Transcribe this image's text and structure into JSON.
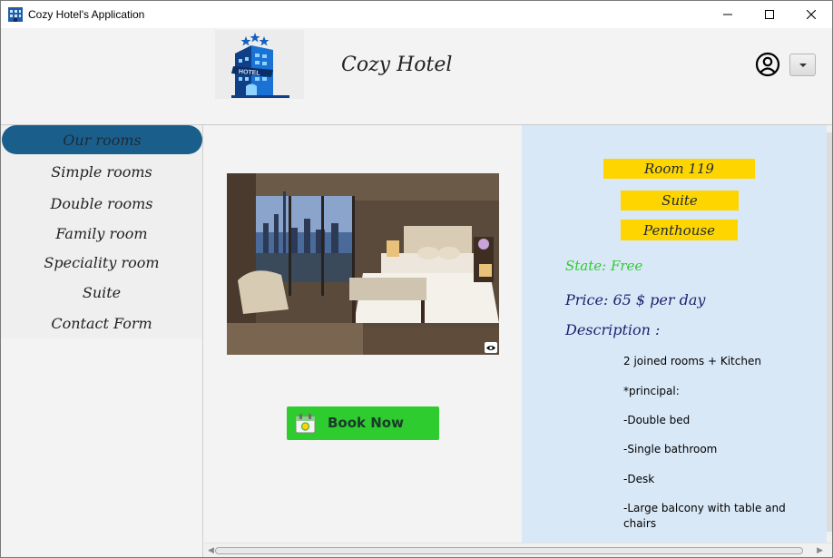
{
  "window": {
    "title": "Cozy Hotel's Application",
    "controls": {
      "minimize": "minimize-icon",
      "maximize": "maximize-icon",
      "close": "close-icon"
    }
  },
  "header": {
    "brand": "Cozy Hotel",
    "logo_text": "HOTEL",
    "account_icon": "user-circle-icon",
    "dropdown_icon": "chevron-down-icon"
  },
  "sidebar": {
    "items": [
      {
        "label": "Our rooms",
        "active": true
      },
      {
        "label": "Simple rooms",
        "active": false
      },
      {
        "label": "Double rooms",
        "active": false
      },
      {
        "label": "Family room",
        "active": false
      },
      {
        "label": "Speciality room",
        "active": false
      },
      {
        "label": "Suite",
        "active": false
      },
      {
        "label": "Contact Form",
        "active": false
      }
    ]
  },
  "center": {
    "photo_icon": "eye-icon",
    "book_button": "Book Now",
    "book_icon": "calendar-icon"
  },
  "details": {
    "room": "Room 119",
    "type": "Suite",
    "subtype": "Penthouse",
    "state": "State: Free",
    "price": "Price: 65 $ per day",
    "description_label": "Description :",
    "description_lines": [
      "2 joined rooms + Kitchen",
      "*principal:",
      "-Double bed",
      "-Single bathroom",
      "-Desk",
      "-Large balcony with table and chairs"
    ]
  },
  "colors": {
    "active_menu": "#1a5f8c",
    "tag_background": "#ffd500",
    "state_free": "#2ecc2e",
    "book_button": "#2ecc2e",
    "details_background": "#d9e8f7",
    "label_text": "#1f1f6e"
  }
}
